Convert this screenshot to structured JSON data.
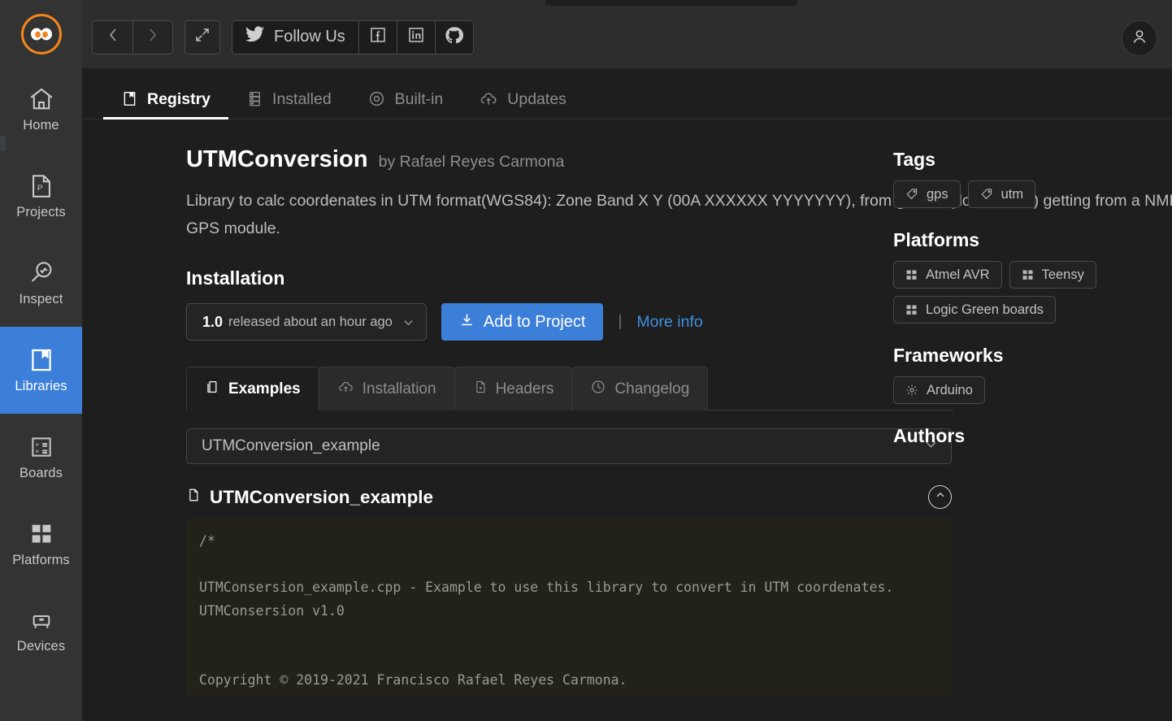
{
  "app": {
    "brand_color": "#f2861b",
    "accent_color": "#3c7fd9",
    "logo_icon": "platformio-alien-logo-icon"
  },
  "activitybar": {
    "items": [
      {
        "label": "Home",
        "icon": "home-icon",
        "active": false
      },
      {
        "label": "Projects",
        "icon": "project-file-icon",
        "active": false
      },
      {
        "label": "Inspect",
        "icon": "magnifier-icon",
        "active": false
      },
      {
        "label": "Libraries",
        "icon": "book-icon",
        "active": true
      },
      {
        "label": "Boards",
        "icon": "calculator-icon",
        "active": false
      },
      {
        "label": "Platforms",
        "icon": "grid-squares-icon",
        "active": false
      },
      {
        "label": "Devices",
        "icon": "device-board-icon",
        "active": false
      }
    ]
  },
  "toolbar": {
    "back_label": "‹",
    "forward_label": "›",
    "expand_title": "Toggle full screen",
    "follow_label": "Follow Us",
    "social": [
      {
        "name": "facebook",
        "glyph": "f"
      },
      {
        "name": "linkedin",
        "glyph": "in"
      },
      {
        "name": "github",
        "glyph": ""
      }
    ],
    "account_label": "Account"
  },
  "main_tabs": [
    {
      "label": "Registry",
      "icon": "book-icon",
      "active": true
    },
    {
      "label": "Installed",
      "icon": "server-icon",
      "active": false
    },
    {
      "label": "Built-in",
      "icon": "eye-icon",
      "active": false
    },
    {
      "label": "Updates",
      "icon": "cloud-upload-icon",
      "active": false
    }
  ],
  "package": {
    "name": "UTMConversion",
    "by_prefix": "by",
    "author": "Rafael Reyes Carmona",
    "byline": "by Rafael Reyes Carmona",
    "description": "Library to calc coordenates in UTM format(WGS84): Zone Band X Y (00A XXXXXX YYYYYYY), from grades (float format) getting from a NMEA GPS module."
  },
  "installation": {
    "heading": "Installation",
    "version_number": "1.0",
    "version_note": "released about an hour ago",
    "add_button": "Add to Project",
    "separator": "|",
    "more_info": "More info"
  },
  "subtabs": [
    {
      "label": "Examples",
      "icon": "copy-icon",
      "active": true
    },
    {
      "label": "Installation",
      "icon": "cloud-upload-icon",
      "active": false
    },
    {
      "label": "Headers",
      "icon": "file-plus-icon",
      "active": false
    },
    {
      "label": "Changelog",
      "icon": "clock-icon",
      "active": false
    }
  ],
  "example": {
    "selected": "UTMConversion_example",
    "title": "UTMConversion_example",
    "collapse_icon": "chevron-up-circle-icon",
    "code": "/*\n\nUTMConsersion_example.cpp - Example to use this library to convert in UTM coordenates.\nUTMConsersion v1.0\n\n\nCopyright © 2019-2021 Francisco Rafael Reyes Carmona.\nAll rights reserved.\n\n\nrafael.reyes.carmona@gmail.com"
  },
  "sidebar": {
    "tags_heading": "Tags",
    "tags": [
      {
        "label": "gps",
        "icon": "tag-icon"
      },
      {
        "label": "utm",
        "icon": "tag-icon"
      }
    ],
    "platforms_heading": "Platforms",
    "platforms": [
      {
        "label": "Atmel AVR",
        "icon": "grid-squares-icon"
      },
      {
        "label": "Teensy",
        "icon": "grid-squares-icon"
      },
      {
        "label": "Logic Green boards",
        "icon": "grid-squares-icon"
      }
    ],
    "frameworks_heading": "Frameworks",
    "frameworks": [
      {
        "label": "Arduino",
        "icon": "gear-icon"
      }
    ],
    "authors_heading": "Authors"
  }
}
